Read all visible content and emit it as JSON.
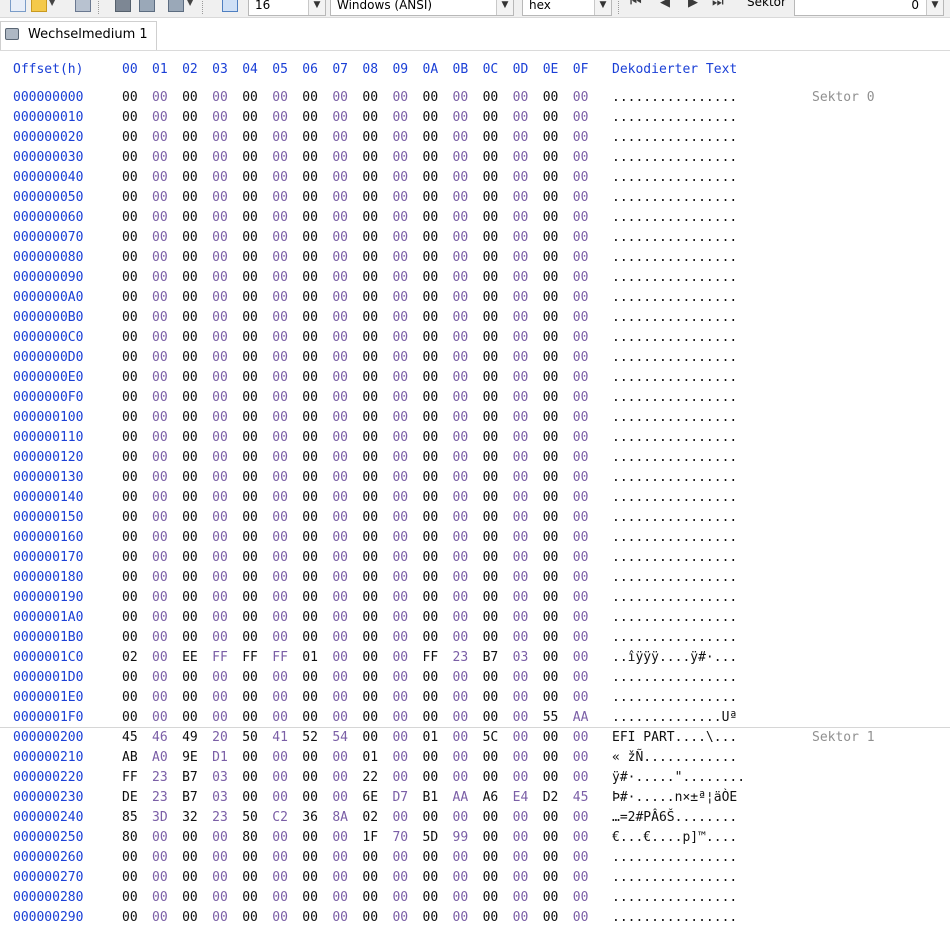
{
  "toolbar": {
    "bytes_per_row": "16",
    "charset": "Windows (ANSI)",
    "mode": "hex",
    "mode_label": "Sektor",
    "mode_value": "0",
    "icons": [
      "new-file-icon",
      "open-folder-icon",
      "save-icon",
      "delete-icon",
      "drive-icon",
      "save-drive-icon",
      "columns-icon",
      "first-icon",
      "prev-icon",
      "next-icon",
      "last-icon"
    ]
  },
  "tab": {
    "title": "Wechselmedium 1"
  },
  "header": {
    "offset": "Offset(h)",
    "columns": [
      "00",
      "01",
      "02",
      "03",
      "04",
      "05",
      "06",
      "07",
      "08",
      "09",
      "0A",
      "0B",
      "0C",
      "0D",
      "0E",
      "0F"
    ],
    "decoded": "Dekodierter Text"
  },
  "rows": [
    {
      "offset": "000000000",
      "bytes": [
        "00",
        "00",
        "00",
        "00",
        "00",
        "00",
        "00",
        "00",
        "00",
        "00",
        "00",
        "00",
        "00",
        "00",
        "00",
        "00"
      ],
      "text": "................",
      "sektor": "Sektor 0"
    },
    {
      "offset": "000000010",
      "bytes": [
        "00",
        "00",
        "00",
        "00",
        "00",
        "00",
        "00",
        "00",
        "00",
        "00",
        "00",
        "00",
        "00",
        "00",
        "00",
        "00"
      ],
      "text": "................",
      "sektor": ""
    },
    {
      "offset": "000000020",
      "bytes": [
        "00",
        "00",
        "00",
        "00",
        "00",
        "00",
        "00",
        "00",
        "00",
        "00",
        "00",
        "00",
        "00",
        "00",
        "00",
        "00"
      ],
      "text": "................",
      "sektor": ""
    },
    {
      "offset": "000000030",
      "bytes": [
        "00",
        "00",
        "00",
        "00",
        "00",
        "00",
        "00",
        "00",
        "00",
        "00",
        "00",
        "00",
        "00",
        "00",
        "00",
        "00"
      ],
      "text": "................",
      "sektor": ""
    },
    {
      "offset": "000000040",
      "bytes": [
        "00",
        "00",
        "00",
        "00",
        "00",
        "00",
        "00",
        "00",
        "00",
        "00",
        "00",
        "00",
        "00",
        "00",
        "00",
        "00"
      ],
      "text": "................",
      "sektor": ""
    },
    {
      "offset": "000000050",
      "bytes": [
        "00",
        "00",
        "00",
        "00",
        "00",
        "00",
        "00",
        "00",
        "00",
        "00",
        "00",
        "00",
        "00",
        "00",
        "00",
        "00"
      ],
      "text": "................",
      "sektor": ""
    },
    {
      "offset": "000000060",
      "bytes": [
        "00",
        "00",
        "00",
        "00",
        "00",
        "00",
        "00",
        "00",
        "00",
        "00",
        "00",
        "00",
        "00",
        "00",
        "00",
        "00"
      ],
      "text": "................",
      "sektor": ""
    },
    {
      "offset": "000000070",
      "bytes": [
        "00",
        "00",
        "00",
        "00",
        "00",
        "00",
        "00",
        "00",
        "00",
        "00",
        "00",
        "00",
        "00",
        "00",
        "00",
        "00"
      ],
      "text": "................",
      "sektor": ""
    },
    {
      "offset": "000000080",
      "bytes": [
        "00",
        "00",
        "00",
        "00",
        "00",
        "00",
        "00",
        "00",
        "00",
        "00",
        "00",
        "00",
        "00",
        "00",
        "00",
        "00"
      ],
      "text": "................",
      "sektor": ""
    },
    {
      "offset": "000000090",
      "bytes": [
        "00",
        "00",
        "00",
        "00",
        "00",
        "00",
        "00",
        "00",
        "00",
        "00",
        "00",
        "00",
        "00",
        "00",
        "00",
        "00"
      ],
      "text": "................",
      "sektor": ""
    },
    {
      "offset": "0000000A0",
      "bytes": [
        "00",
        "00",
        "00",
        "00",
        "00",
        "00",
        "00",
        "00",
        "00",
        "00",
        "00",
        "00",
        "00",
        "00",
        "00",
        "00"
      ],
      "text": "................",
      "sektor": ""
    },
    {
      "offset": "0000000B0",
      "bytes": [
        "00",
        "00",
        "00",
        "00",
        "00",
        "00",
        "00",
        "00",
        "00",
        "00",
        "00",
        "00",
        "00",
        "00",
        "00",
        "00"
      ],
      "text": "................",
      "sektor": ""
    },
    {
      "offset": "0000000C0",
      "bytes": [
        "00",
        "00",
        "00",
        "00",
        "00",
        "00",
        "00",
        "00",
        "00",
        "00",
        "00",
        "00",
        "00",
        "00",
        "00",
        "00"
      ],
      "text": "................",
      "sektor": ""
    },
    {
      "offset": "0000000D0",
      "bytes": [
        "00",
        "00",
        "00",
        "00",
        "00",
        "00",
        "00",
        "00",
        "00",
        "00",
        "00",
        "00",
        "00",
        "00",
        "00",
        "00"
      ],
      "text": "................",
      "sektor": ""
    },
    {
      "offset": "0000000E0",
      "bytes": [
        "00",
        "00",
        "00",
        "00",
        "00",
        "00",
        "00",
        "00",
        "00",
        "00",
        "00",
        "00",
        "00",
        "00",
        "00",
        "00"
      ],
      "text": "................",
      "sektor": ""
    },
    {
      "offset": "0000000F0",
      "bytes": [
        "00",
        "00",
        "00",
        "00",
        "00",
        "00",
        "00",
        "00",
        "00",
        "00",
        "00",
        "00",
        "00",
        "00",
        "00",
        "00"
      ],
      "text": "................",
      "sektor": ""
    },
    {
      "offset": "000000100",
      "bytes": [
        "00",
        "00",
        "00",
        "00",
        "00",
        "00",
        "00",
        "00",
        "00",
        "00",
        "00",
        "00",
        "00",
        "00",
        "00",
        "00"
      ],
      "text": "................",
      "sektor": ""
    },
    {
      "offset": "000000110",
      "bytes": [
        "00",
        "00",
        "00",
        "00",
        "00",
        "00",
        "00",
        "00",
        "00",
        "00",
        "00",
        "00",
        "00",
        "00",
        "00",
        "00"
      ],
      "text": "................",
      "sektor": ""
    },
    {
      "offset": "000000120",
      "bytes": [
        "00",
        "00",
        "00",
        "00",
        "00",
        "00",
        "00",
        "00",
        "00",
        "00",
        "00",
        "00",
        "00",
        "00",
        "00",
        "00"
      ],
      "text": "................",
      "sektor": ""
    },
    {
      "offset": "000000130",
      "bytes": [
        "00",
        "00",
        "00",
        "00",
        "00",
        "00",
        "00",
        "00",
        "00",
        "00",
        "00",
        "00",
        "00",
        "00",
        "00",
        "00"
      ],
      "text": "................",
      "sektor": ""
    },
    {
      "offset": "000000140",
      "bytes": [
        "00",
        "00",
        "00",
        "00",
        "00",
        "00",
        "00",
        "00",
        "00",
        "00",
        "00",
        "00",
        "00",
        "00",
        "00",
        "00"
      ],
      "text": "................",
      "sektor": ""
    },
    {
      "offset": "000000150",
      "bytes": [
        "00",
        "00",
        "00",
        "00",
        "00",
        "00",
        "00",
        "00",
        "00",
        "00",
        "00",
        "00",
        "00",
        "00",
        "00",
        "00"
      ],
      "text": "................",
      "sektor": ""
    },
    {
      "offset": "000000160",
      "bytes": [
        "00",
        "00",
        "00",
        "00",
        "00",
        "00",
        "00",
        "00",
        "00",
        "00",
        "00",
        "00",
        "00",
        "00",
        "00",
        "00"
      ],
      "text": "................",
      "sektor": ""
    },
    {
      "offset": "000000170",
      "bytes": [
        "00",
        "00",
        "00",
        "00",
        "00",
        "00",
        "00",
        "00",
        "00",
        "00",
        "00",
        "00",
        "00",
        "00",
        "00",
        "00"
      ],
      "text": "................",
      "sektor": ""
    },
    {
      "offset": "000000180",
      "bytes": [
        "00",
        "00",
        "00",
        "00",
        "00",
        "00",
        "00",
        "00",
        "00",
        "00",
        "00",
        "00",
        "00",
        "00",
        "00",
        "00"
      ],
      "text": "................",
      "sektor": ""
    },
    {
      "offset": "000000190",
      "bytes": [
        "00",
        "00",
        "00",
        "00",
        "00",
        "00",
        "00",
        "00",
        "00",
        "00",
        "00",
        "00",
        "00",
        "00",
        "00",
        "00"
      ],
      "text": "................",
      "sektor": ""
    },
    {
      "offset": "0000001A0",
      "bytes": [
        "00",
        "00",
        "00",
        "00",
        "00",
        "00",
        "00",
        "00",
        "00",
        "00",
        "00",
        "00",
        "00",
        "00",
        "00",
        "00"
      ],
      "text": "................",
      "sektor": ""
    },
    {
      "offset": "0000001B0",
      "bytes": [
        "00",
        "00",
        "00",
        "00",
        "00",
        "00",
        "00",
        "00",
        "00",
        "00",
        "00",
        "00",
        "00",
        "00",
        "00",
        "00"
      ],
      "text": "................",
      "sektor": ""
    },
    {
      "offset": "0000001C0",
      "bytes": [
        "02",
        "00",
        "EE",
        "FF",
        "FF",
        "FF",
        "01",
        "00",
        "00",
        "00",
        "FF",
        "23",
        "B7",
        "03",
        "00",
        "00"
      ],
      "text": "..îÿÿÿ....ÿ#·...",
      "sektor": ""
    },
    {
      "offset": "0000001D0",
      "bytes": [
        "00",
        "00",
        "00",
        "00",
        "00",
        "00",
        "00",
        "00",
        "00",
        "00",
        "00",
        "00",
        "00",
        "00",
        "00",
        "00"
      ],
      "text": "................",
      "sektor": ""
    },
    {
      "offset": "0000001E0",
      "bytes": [
        "00",
        "00",
        "00",
        "00",
        "00",
        "00",
        "00",
        "00",
        "00",
        "00",
        "00",
        "00",
        "00",
        "00",
        "00",
        "00"
      ],
      "text": "................",
      "sektor": ""
    },
    {
      "offset": "0000001F0",
      "bytes": [
        "00",
        "00",
        "00",
        "00",
        "00",
        "00",
        "00",
        "00",
        "00",
        "00",
        "00",
        "00",
        "00",
        "00",
        "55",
        "AA"
      ],
      "text": "..............Uª",
      "sektor": ""
    },
    {
      "offset": "000000200",
      "bytes": [
        "45",
        "46",
        "49",
        "20",
        "50",
        "41",
        "52",
        "54",
        "00",
        "00",
        "01",
        "00",
        "5C",
        "00",
        "00",
        "00"
      ],
      "text": "EFI PART....\\...",
      "sektor": "Sektor 1"
    },
    {
      "offset": "000000210",
      "bytes": [
        "AB",
        "A0",
        "9E",
        "D1",
        "00",
        "00",
        "00",
        "00",
        "01",
        "00",
        "00",
        "00",
        "00",
        "00",
        "00",
        "00"
      ],
      "text": "« žÑ............",
      "sektor": ""
    },
    {
      "offset": "000000220",
      "bytes": [
        "FF",
        "23",
        "B7",
        "03",
        "00",
        "00",
        "00",
        "00",
        "22",
        "00",
        "00",
        "00",
        "00",
        "00",
        "00",
        "00"
      ],
      "text": "ÿ#·.....\"........",
      "sektor": ""
    },
    {
      "offset": "000000230",
      "bytes": [
        "DE",
        "23",
        "B7",
        "03",
        "00",
        "00",
        "00",
        "00",
        "6E",
        "D7",
        "B1",
        "AA",
        "A6",
        "E4",
        "D2",
        "45"
      ],
      "text": "Þ#·.....n×±ª¦äÒE",
      "sektor": ""
    },
    {
      "offset": "000000240",
      "bytes": [
        "85",
        "3D",
        "32",
        "23",
        "50",
        "C2",
        "36",
        "8A",
        "02",
        "00",
        "00",
        "00",
        "00",
        "00",
        "00",
        "00"
      ],
      "text": "…=2#PÂ6Š........",
      "sektor": ""
    },
    {
      "offset": "000000250",
      "bytes": [
        "80",
        "00",
        "00",
        "00",
        "80",
        "00",
        "00",
        "00",
        "1F",
        "70",
        "5D",
        "99",
        "00",
        "00",
        "00",
        "00"
      ],
      "text": "€...€....p]™....",
      "sektor": ""
    },
    {
      "offset": "000000260",
      "bytes": [
        "00",
        "00",
        "00",
        "00",
        "00",
        "00",
        "00",
        "00",
        "00",
        "00",
        "00",
        "00",
        "00",
        "00",
        "00",
        "00"
      ],
      "text": "................",
      "sektor": ""
    },
    {
      "offset": "000000270",
      "bytes": [
        "00",
        "00",
        "00",
        "00",
        "00",
        "00",
        "00",
        "00",
        "00",
        "00",
        "00",
        "00",
        "00",
        "00",
        "00",
        "00"
      ],
      "text": "................",
      "sektor": ""
    },
    {
      "offset": "000000280",
      "bytes": [
        "00",
        "00",
        "00",
        "00",
        "00",
        "00",
        "00",
        "00",
        "00",
        "00",
        "00",
        "00",
        "00",
        "00",
        "00",
        "00"
      ],
      "text": "................",
      "sektor": ""
    },
    {
      "offset": "000000290",
      "bytes": [
        "00",
        "00",
        "00",
        "00",
        "00",
        "00",
        "00",
        "00",
        "00",
        "00",
        "00",
        "00",
        "00",
        "00",
        "00",
        "00"
      ],
      "text": "................",
      "sektor": ""
    }
  ],
  "colors": {
    "offset_blue": "#1a3fd6",
    "even_byte": "#101010",
    "odd_byte": "#7a5ea6",
    "sektor_gray": "#909090"
  }
}
